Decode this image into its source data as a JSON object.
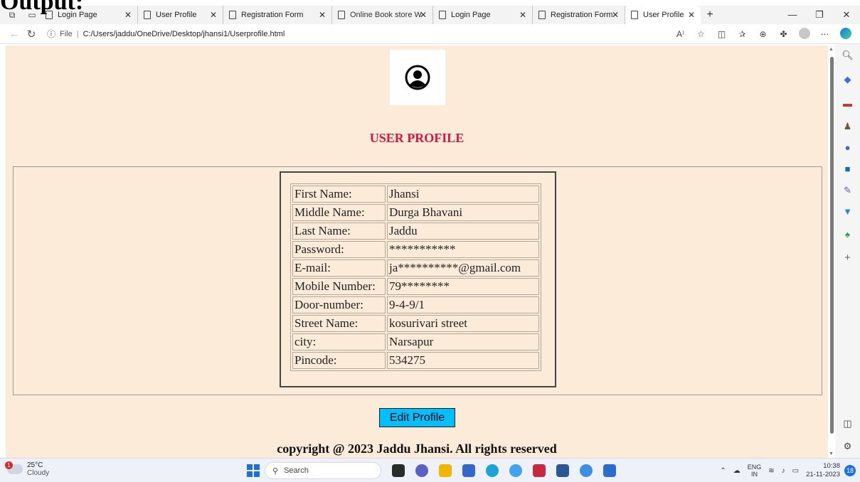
{
  "doc_heading": "Output:",
  "browser": {
    "tabs": [
      {
        "label": "Login Page"
      },
      {
        "label": "User Profile"
      },
      {
        "label": "Registration Form"
      },
      {
        "label": "Online Book store W"
      },
      {
        "label": "Login Page"
      },
      {
        "label": "Registration Form"
      },
      {
        "label": "User Profile",
        "active": true
      }
    ],
    "address": {
      "scheme": "File",
      "url": "C:/Users/jaddu/OneDrive/Desktop/jhansi1/Userprofile.html"
    }
  },
  "page": {
    "title": "USER PROFILE",
    "profile": [
      {
        "label": "First Name:",
        "value": "Jhansi"
      },
      {
        "label": "Middle Name:",
        "value": "Durga Bhavani"
      },
      {
        "label": "Last Name:",
        "value": "Jaddu"
      },
      {
        "label": "Password:",
        "value": "***********"
      },
      {
        "label": "E-mail:",
        "value": "ja**********@gmail.com"
      },
      {
        "label": "Mobile Number:",
        "value": "79********"
      },
      {
        "label": "Door-number:",
        "value": "9-4-9/1"
      },
      {
        "label": "Street Name:",
        "value": "kosurivari street"
      },
      {
        "label": "city:",
        "value": "Narsapur"
      },
      {
        "label": "Pincode:",
        "value": "534275"
      }
    ],
    "edit_button": "Edit Profile",
    "copyright": "copyright @ 2023 Jaddu Jhansi. All rights reserved"
  },
  "taskbar": {
    "weather": {
      "temp": "25°C",
      "condition": "Cloudy",
      "badge": "1"
    },
    "search_placeholder": "Search",
    "lang": {
      "top": "ENG",
      "bottom": "IN"
    },
    "clock": {
      "time": "10:38",
      "date": "21-11-2023"
    },
    "notification_count": "18"
  },
  "colors": {
    "page_bg": "#fbebd8",
    "title": "#dc143c",
    "button": "#00bfff"
  }
}
